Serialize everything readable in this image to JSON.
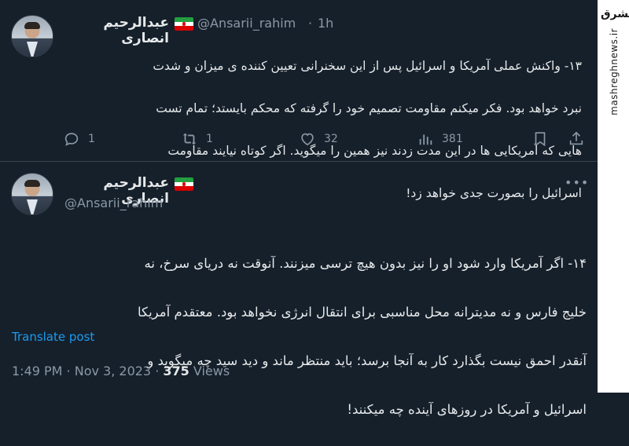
{
  "tweet1": {
    "name": "عبدالرحیم انصاری",
    "handle": "@Ansarii_rahim",
    "separator": "·",
    "time": "1h",
    "lines": [
      "۱۳- واکنش عملی آمریکا و اسرائیل پس از این سخنرانی تعیین کننده ی میزان و شدت",
      "نبرد خواهد بود. فکر میکنم مقاومت تصمیم خود را گرفته که محکم بایستد؛ تمام تست",
      "هایی که آمریکایی ها در این مدت زدند نیز همین را میگوید. اگر کوتاه نیایند مقاومت",
      "اسرائیل را بصورت جدی خواهد زد!"
    ],
    "replies": "1",
    "reposts": "1",
    "likes": "32",
    "views": "381"
  },
  "tweet2": {
    "name": "عبدالرحیم انصاری",
    "handle": "@Ansarii_rahim",
    "lines": [
      "۱۴- اگر آمریکا وارد شود او را نیز بدون هیچ ترسی میزنند. آنوقت نه دریای سرخ، نه",
      "خلیج فارس و نه مدیترانه محل مناسبی برای انتقال انرژی نخواهد بود. معتقدم آمریکا",
      "آنقدر احمق نیست بگذارد کار به آنجا برسد؛ باید منتظر ماند و دید سید چه میگوید و",
      "اسرائیل و آمریکا در روزهای آینده چه میکنند!"
    ],
    "translate": "Translate post",
    "meta_time": "1:49 PM · Nov 3, 2023 · ",
    "meta_views_count": "375",
    "meta_views_label": " Views"
  },
  "watermark": {
    "logo": "مشرق",
    "url": "mashreghnews.ir"
  },
  "colors": {
    "background": "#15202b",
    "text": "#e7e9ea",
    "muted": "#8b98a5",
    "link": "#1d9bf0"
  }
}
